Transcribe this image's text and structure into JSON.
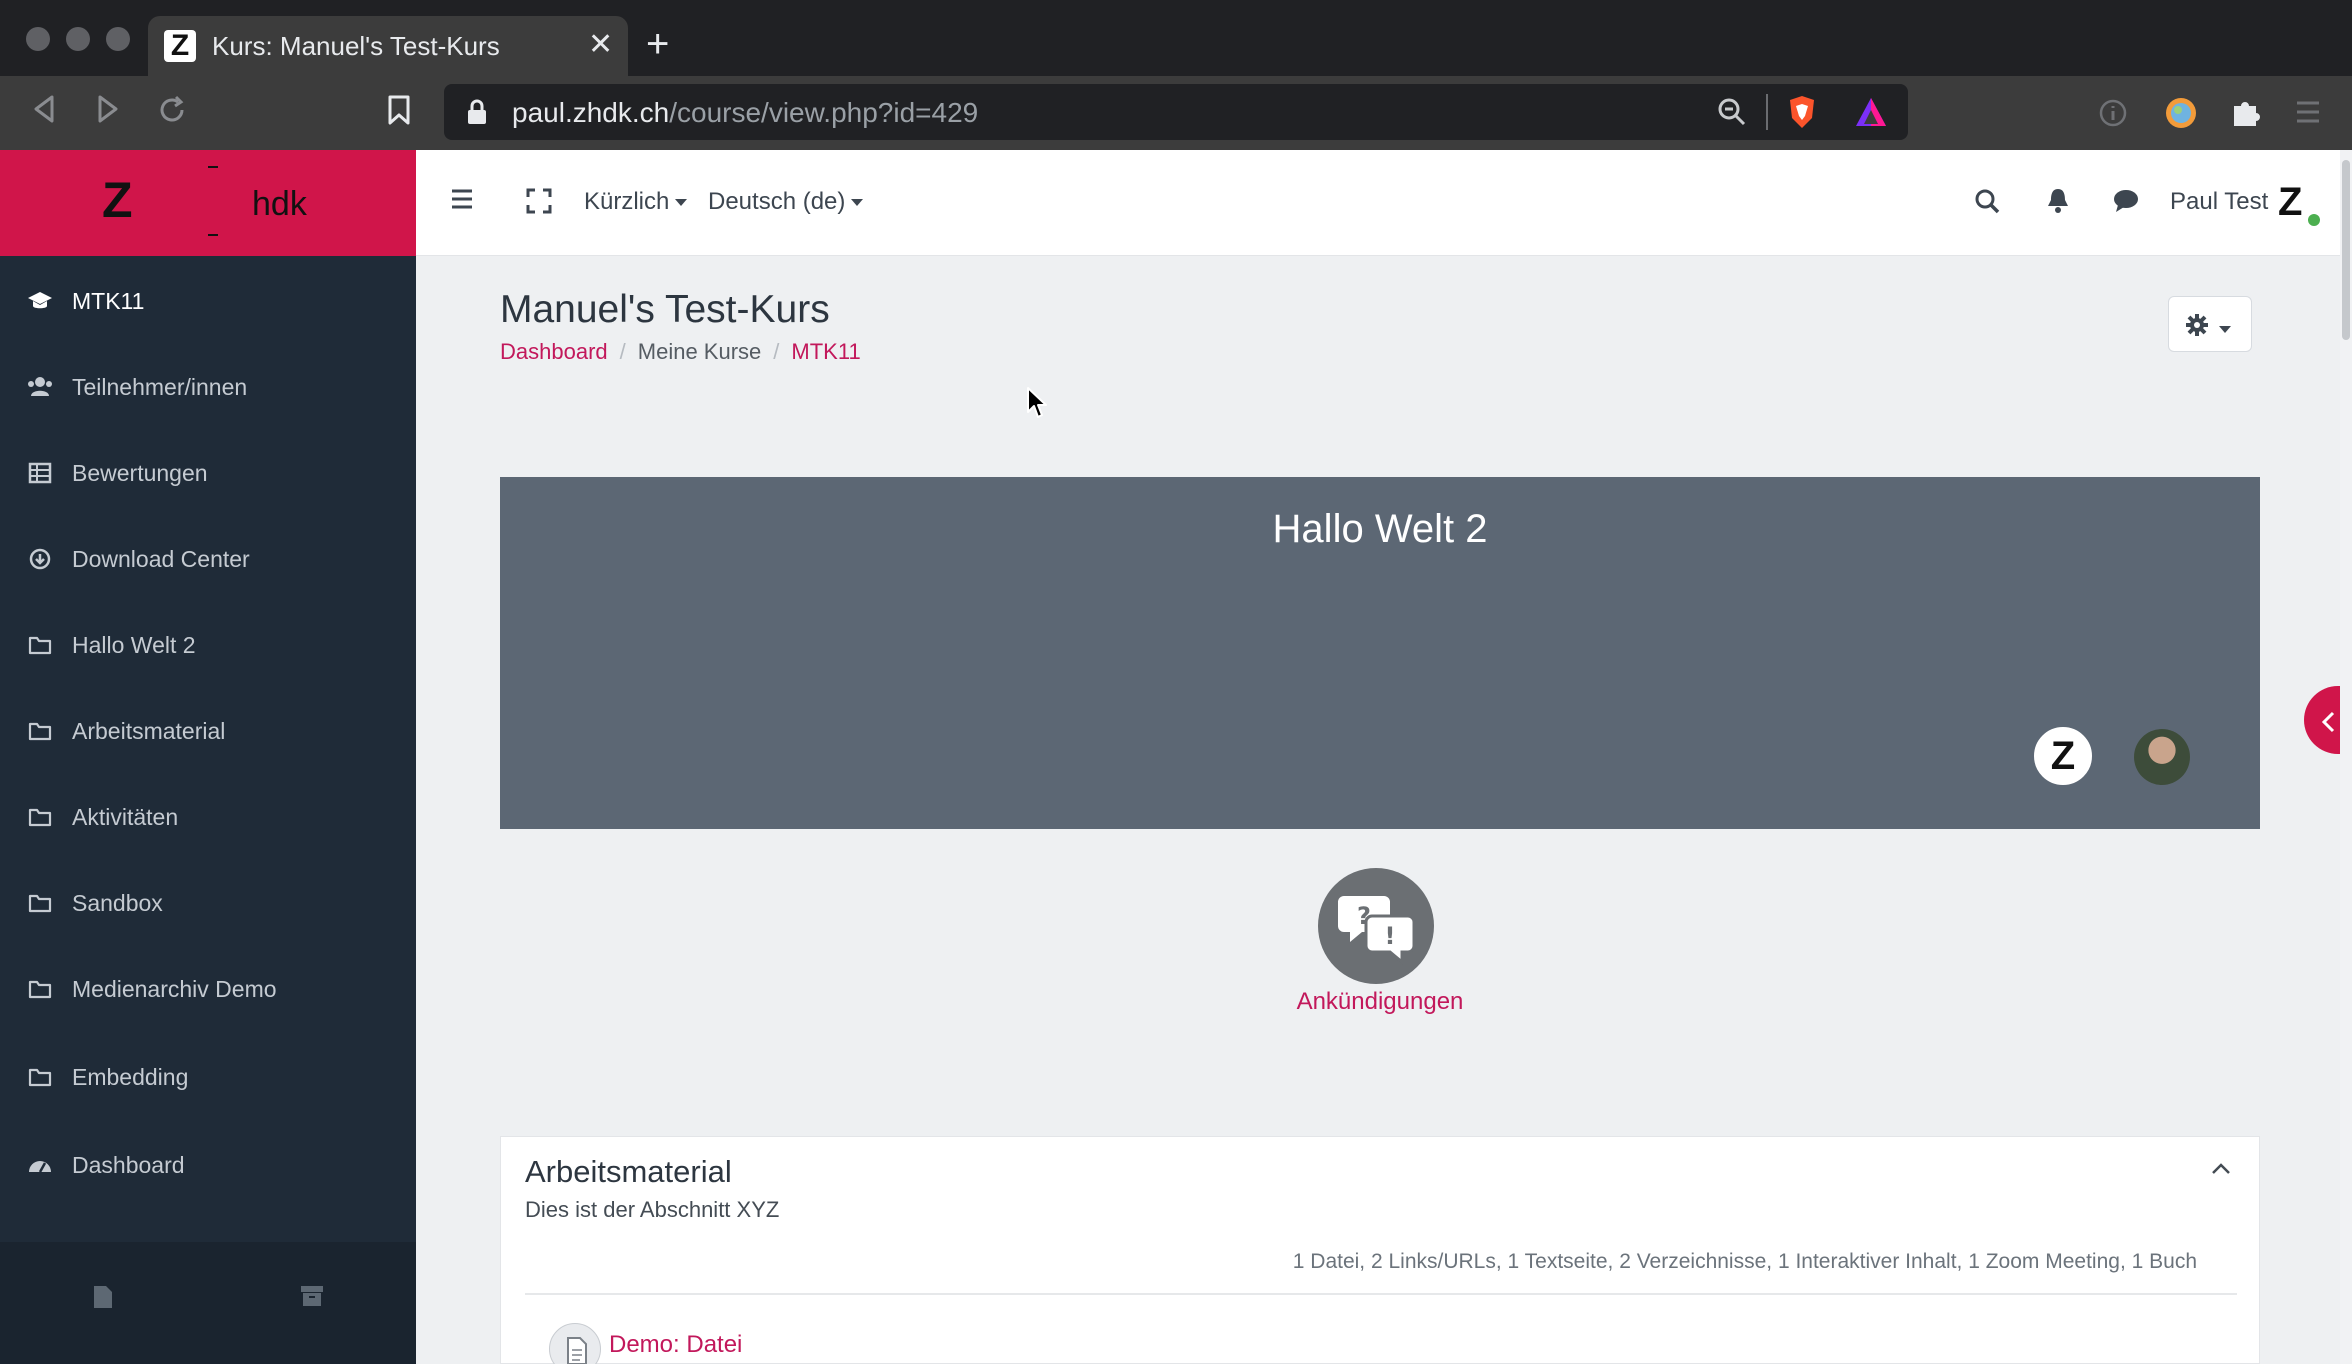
{
  "browser": {
    "tab_title": "Kurs: Manuel's Test-Kurs",
    "tab_favicon_letter": "Z",
    "url_host": "paul.zhdk.ch",
    "url_path": "/course/view.php?id=429"
  },
  "site": {
    "logo_letter": "Z",
    "logo_text": "hdk"
  },
  "sidebar": {
    "items": [
      {
        "label": "MTK11",
        "icon": "graduation-cap-icon",
        "active": true
      },
      {
        "label": "Teilnehmer/innen",
        "icon": "users-icon"
      },
      {
        "label": "Bewertungen",
        "icon": "table-icon"
      },
      {
        "label": "Download Center",
        "icon": "download-icon"
      },
      {
        "label": "Hallo Welt 2",
        "icon": "folder-icon"
      },
      {
        "label": "Arbeitsmaterial",
        "icon": "folder-icon"
      },
      {
        "label": "Aktivitäten",
        "icon": "folder-icon"
      },
      {
        "label": "Sandbox",
        "icon": "folder-icon"
      },
      {
        "label": "Medienarchiv Demo",
        "icon": "folder-icon"
      },
      {
        "label": "Embedding",
        "icon": "folder-icon"
      },
      {
        "label": "Dashboard",
        "icon": "dashboard-icon"
      }
    ]
  },
  "navbar": {
    "recent_label": "Kürzlich",
    "language_label": "Deutsch (de)",
    "user_name": "Paul Test",
    "user_avatar_letter": "Z"
  },
  "page": {
    "title": "Manuel's Test-Kurs",
    "breadcrumb": [
      "Dashboard",
      "Meine Kurse",
      "MTK11"
    ]
  },
  "hero": {
    "title": "Hallo Welt 2",
    "logo_letter": "Z"
  },
  "announcements": {
    "label": "Ankündigungen"
  },
  "section": {
    "title": "Arbeitsmaterial",
    "summary": "Dies ist der Abschnitt XYZ",
    "stats": "1 Datei, 2 Links/URLs, 1 Textseite, 2 Verzeichnisse, 1 Interaktiver Inhalt, 1 Zoom Meeting, 1 Buch",
    "first_activity": "Demo: Datei"
  },
  "colors": {
    "brand": "#d0154a",
    "link": "#c2185b",
    "sidebar_bg": "#1f2b38",
    "hero_bg": "#5c6774"
  }
}
